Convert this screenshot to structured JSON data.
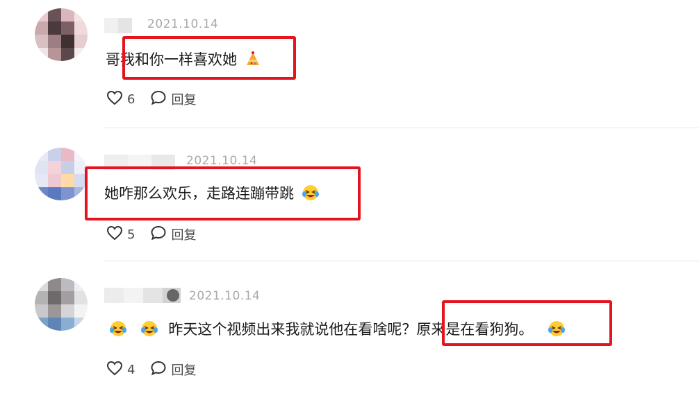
{
  "comments": [
    {
      "timestamp": "2021.10.14",
      "text": "哥我和你一样喜欢她",
      "emoji": "party-hat-emoji",
      "likes": "6",
      "reply_label": "回复"
    },
    {
      "timestamp": "2021.10.14",
      "text": "她咋那么欢乐，走路连蹦带跳",
      "emoji": "laughing-tears-emoji",
      "likes": "5",
      "reply_label": "回复"
    },
    {
      "timestamp": "2021.10.14",
      "text": "昨天这个视频出来我就说他在看啥呢？原来是在看狗狗。",
      "emoji": "laughing-tears-emoji",
      "likes": "4",
      "reply_label": "回复"
    }
  ],
  "colors": {
    "highlight": "#e3141d",
    "timestamp": "#a9a9a9",
    "divider": "#e6e6e6"
  }
}
